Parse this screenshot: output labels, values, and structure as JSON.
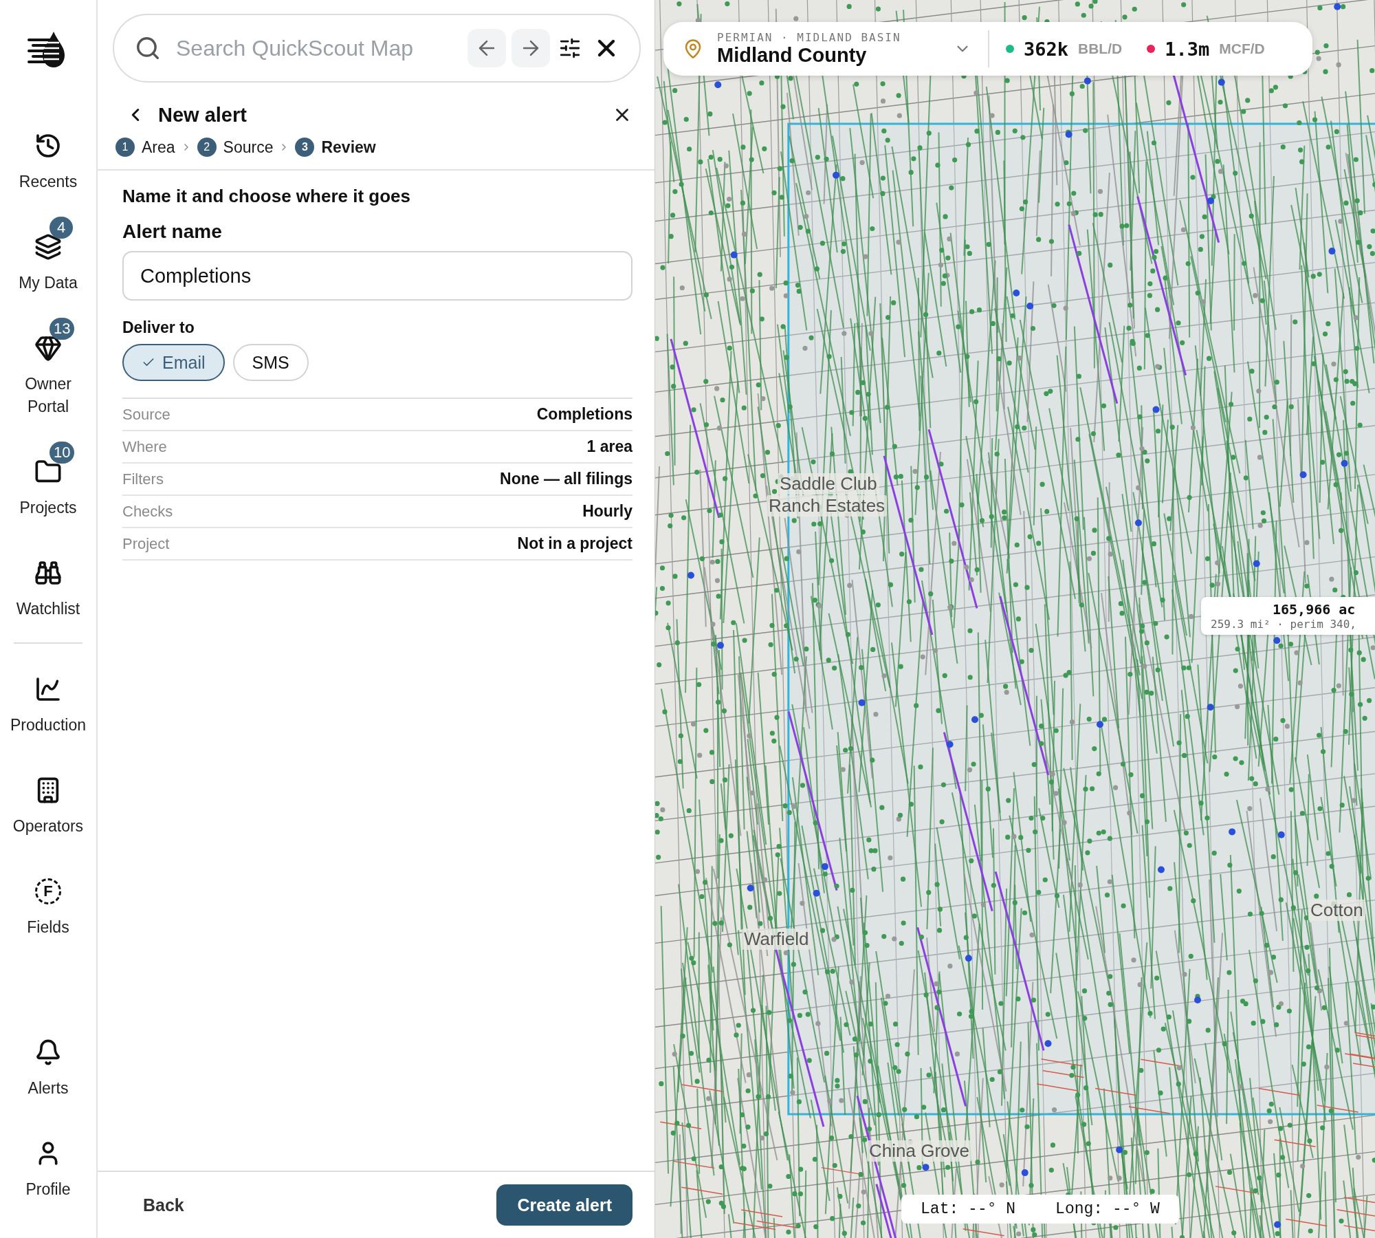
{
  "sidebar": {
    "groups": [
      {
        "items": [
          {
            "label": "Recents",
            "kind": "recents"
          },
          {
            "label": "My Data",
            "kind": "layers",
            "badge": "4"
          },
          {
            "label": "Owner Portal",
            "kind": "tag",
            "badge": "13"
          },
          {
            "label": "Projects",
            "kind": "folder",
            "badge": "10"
          },
          {
            "label": "Watchlist",
            "kind": "binoculars"
          }
        ]
      },
      {
        "items": [
          {
            "label": "Production",
            "kind": "chart"
          },
          {
            "label": "Operators",
            "kind": "building"
          },
          {
            "label": "Fields",
            "kind": "letter",
            "glyph": "F"
          }
        ]
      },
      {
        "items": [
          {
            "label": "Alerts",
            "kind": "bell"
          },
          {
            "label": "Profile",
            "kind": "user"
          }
        ]
      }
    ]
  },
  "search": {
    "placeholder": "Search QuickScout Map"
  },
  "alert": {
    "title": "New alert",
    "steps": [
      {
        "number": "1",
        "label": "Area",
        "selected": false
      },
      {
        "number": "2",
        "label": "Source",
        "selected": false
      },
      {
        "number": "3",
        "label": "Review",
        "selected": true
      }
    ],
    "heading": "Name it and choose where it goes",
    "name_label": "Alert name",
    "name_value": "Completions",
    "deliver_label": "Deliver to",
    "deliver_options": [
      {
        "label": "Email",
        "selected": true
      },
      {
        "label": "SMS",
        "selected": false
      }
    ],
    "summary": [
      {
        "label": "Source",
        "value": "Completions"
      },
      {
        "label": "Where",
        "value": "1 area"
      },
      {
        "label": "Filters",
        "value": "None — all filings"
      },
      {
        "label": "Checks",
        "value": "Hourly"
      },
      {
        "label": "Project",
        "value": "Not in a project"
      }
    ],
    "back": "Back",
    "submit": "Create alert"
  },
  "map": {
    "region": "PERMIAN · MIDLAND BASIN",
    "county": "Midland County",
    "stats": [
      {
        "value": "362k",
        "unit": "BBL/D",
        "color": "#1dbb88"
      },
      {
        "value": "1.3m",
        "unit": "MCF/D",
        "color": "#e8245a"
      }
    ],
    "area": {
      "primary": "165,966 ac",
      "secondary": "259.3 mi² · perim 340,"
    },
    "places": [
      "Saddle Club",
      "Ranch Estates",
      "Warfield",
      "China Grove",
      "Cotton"
    ],
    "coords": {
      "lat": "Lat: --° N",
      "long": "Long: --° W"
    }
  }
}
